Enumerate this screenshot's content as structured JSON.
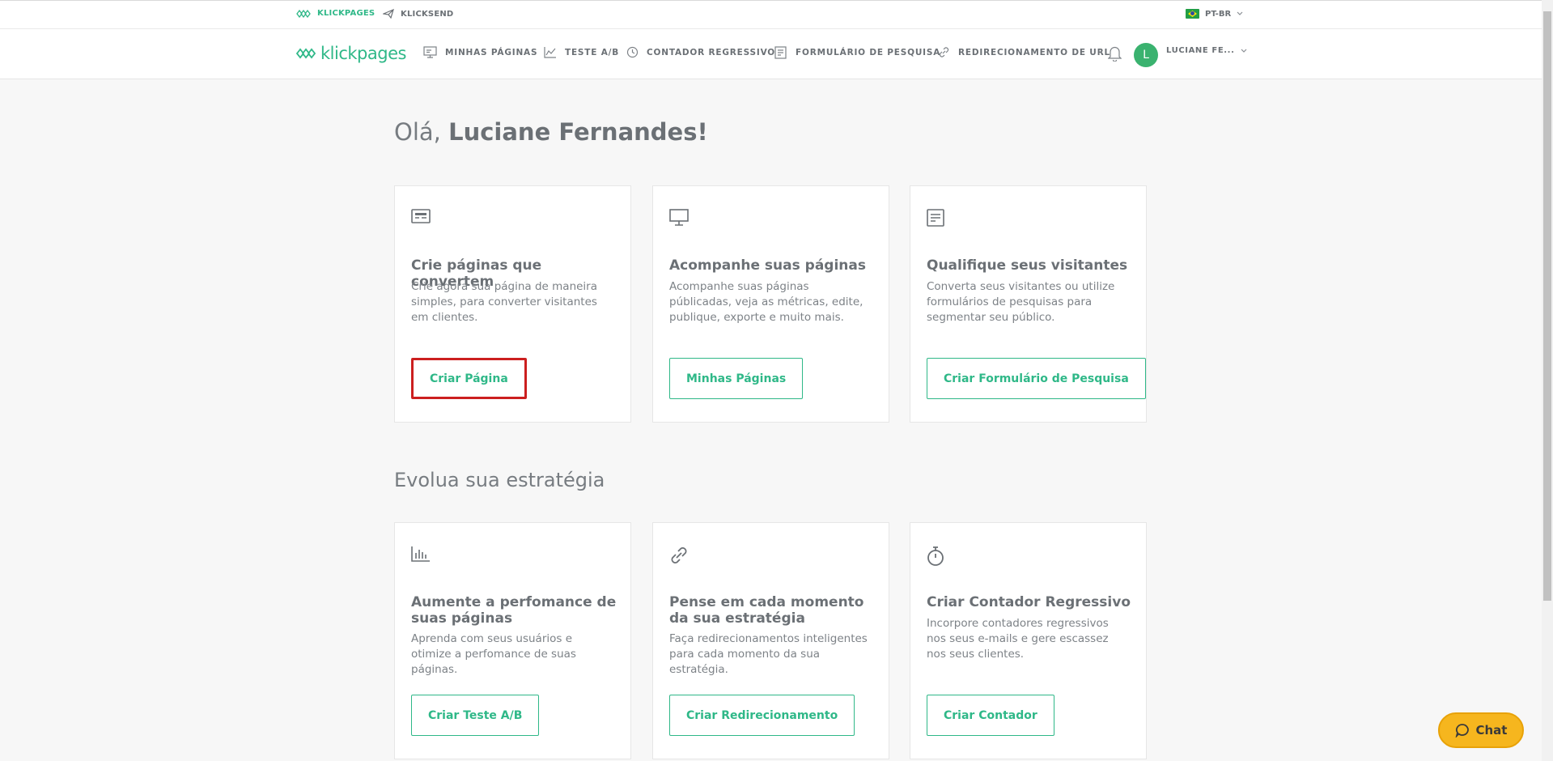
{
  "topbar": {
    "products": [
      {
        "label": "KLICKPAGES",
        "icon": "klickpages-logo-icon",
        "active": true
      },
      {
        "label": "KLICKSEND",
        "icon": "paper-plane-icon",
        "active": false
      }
    ],
    "language": "PT-BR"
  },
  "navbar": {
    "logo_text": "klickpages",
    "items": [
      {
        "label": "MINHAS PÁGINAS",
        "icon": "monitor-icon"
      },
      {
        "label": "TESTE A/B",
        "icon": "chart-line-icon"
      },
      {
        "label": "CONTADOR REGRESSIVO",
        "icon": "clock-icon"
      },
      {
        "label": "FORMULÁRIO DE PESQUISA",
        "icon": "form-icon"
      },
      {
        "label": "REDIRECIONAMENTO DE URL",
        "icon": "link-icon"
      }
    ],
    "avatar_initial": "L",
    "user_name": "LUCIANE FE..."
  },
  "greeting": {
    "prefix": "Olá,",
    "name": "Luciane Fernandes!"
  },
  "cards_top": [
    {
      "icon": "page-editor-icon",
      "title": "Crie páginas que convertem",
      "text": "Crie agora sua página de maneira simples, para converter visitantes em clientes.",
      "button": "Criar Página"
    },
    {
      "icon": "monitor-icon",
      "title": "Acompanhe suas páginas",
      "text": "Acompanhe suas páginas públicadas, veja as métricas, edite, publique, exporte e muito mais.",
      "button": "Minhas Páginas"
    },
    {
      "icon": "form-icon",
      "title": "Qualifique seus visitantes",
      "text": "Converta seus visitantes ou utilize formulários de pesquisas para segmentar seu público.",
      "button": "Criar Formulário de Pesquisa"
    }
  ],
  "section2_title": "Evolua sua estratégia",
  "cards_bottom": [
    {
      "icon": "bar-chart-icon",
      "title": "Aumente a perfomance de suas páginas",
      "text": "Aprenda com seus usuários e otimize a perfomance de suas páginas.",
      "button": "Criar Teste A/B"
    },
    {
      "icon": "link-icon",
      "title": "Pense em cada momento da sua estratégia",
      "text": "Faça redirecionamentos inteligentes para cada momento da sua estratégia.",
      "button": "Criar Redirecionamento"
    },
    {
      "icon": "stopwatch-icon",
      "title": "Criar Contador Regressivo",
      "text": "Incorpore contadores regressivos nos seus e-mails e gere escassez nos seus clientes.",
      "button": "Criar Contador"
    }
  ],
  "chat": {
    "label": "Chat"
  },
  "colors": {
    "brand": "#2fb888",
    "highlight": "#cc1f1f",
    "chat": "#f6b61e",
    "avatar": "#3ab26f"
  }
}
